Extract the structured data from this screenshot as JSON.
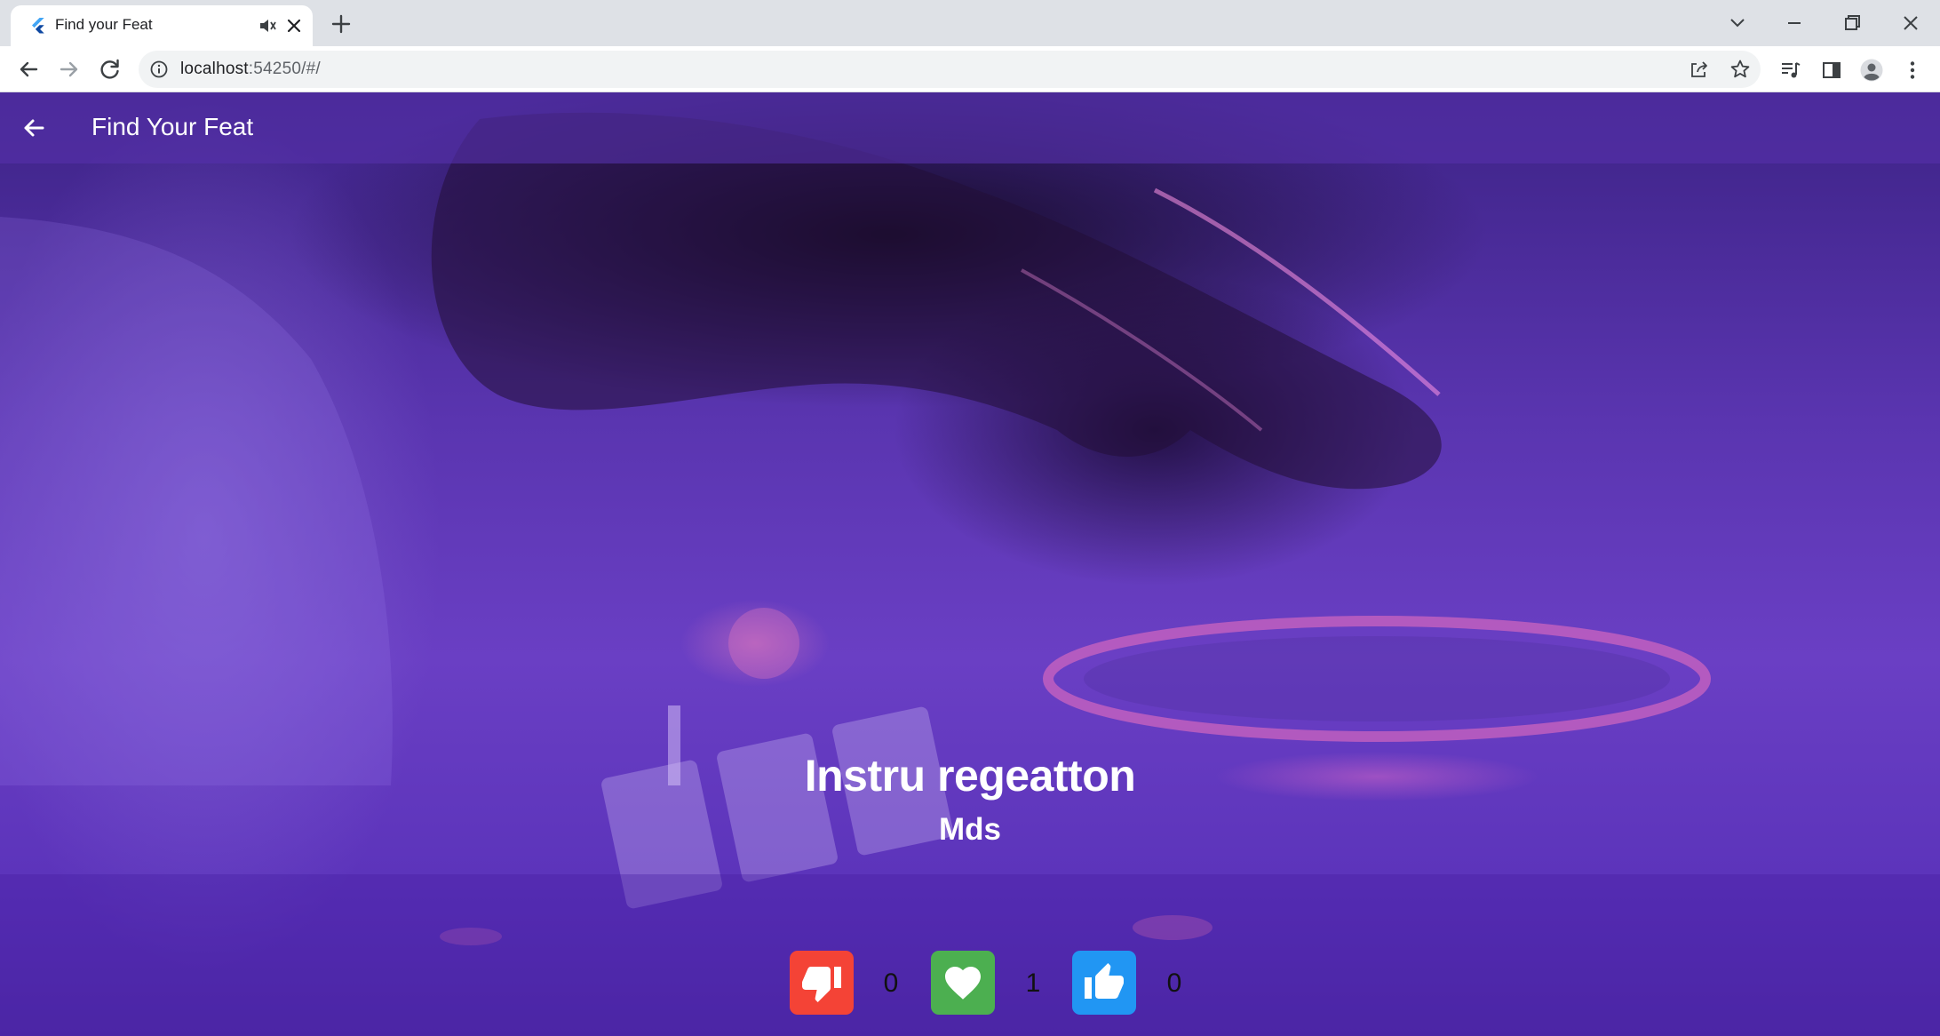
{
  "browser": {
    "tab_title": "Find your Feat",
    "url_host": "localhost",
    "url_rest": ":54250/#/"
  },
  "app": {
    "title": "Find Your Feat",
    "song_title": "Instru regeatton",
    "artist": "Mds",
    "votes": {
      "dislike": "0",
      "love": "1",
      "like": "0"
    }
  },
  "colors": {
    "dislike": "#f44336",
    "love": "#4caf50",
    "like": "#2196f3"
  }
}
